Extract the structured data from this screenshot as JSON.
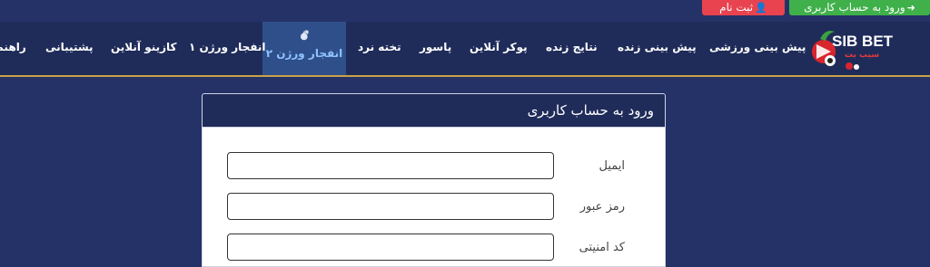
{
  "top": {
    "login_label": "ورود به حساب کاربری",
    "register_label": "ثبت نام"
  },
  "nav": {
    "items": [
      {
        "label": "پیش بینی ورزشی"
      },
      {
        "label": "پیش بینی زنده"
      },
      {
        "label": "نتایج زنده"
      },
      {
        "label": "پوکر آنلاین"
      },
      {
        "label": "پاسور"
      },
      {
        "label": "تخته نرد"
      },
      {
        "label": "انفجار ورژن ۲",
        "active": true
      },
      {
        "label": "انفجار ورژن ۱"
      },
      {
        "label": "کازینو آنلاین"
      },
      {
        "label": "پشتیبانی"
      },
      {
        "label": "راهنما"
      }
    ]
  },
  "logo": {
    "text": "SIB BET",
    "sub": "سیب بت"
  },
  "form": {
    "title": "ورود به حساب کاربری",
    "email_label": "ایمیل",
    "password_label": "رمز عبور",
    "captcha_label": "کد امنیتی"
  },
  "colors": {
    "header_bg": "#253267",
    "nav_bg": "#1f2c5a",
    "active_tab": "#2f4f8a",
    "login_green": "#3fb04a",
    "register_red": "#e8434f",
    "accent_gold": "#c9a24a"
  }
}
